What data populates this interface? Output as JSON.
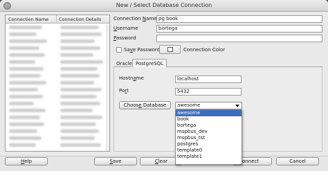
{
  "window": {
    "title": "New / Select Database Connection"
  },
  "connections": {
    "columns": [
      "Connection Name",
      "Connection Details"
    ]
  },
  "form": {
    "connection_name": {
      "label_pre": "Connection ",
      "label_ul": "N",
      "label_post": "ame",
      "value": "pg book"
    },
    "username": {
      "label_ul": "U",
      "label_post": "sername",
      "value": "bortega"
    },
    "password": {
      "label_ul": "P",
      "label_post": "assword",
      "value": ""
    },
    "save_password": {
      "label_pre": "Sa",
      "label_ul": "v",
      "label_post": "e Password",
      "checked": false
    },
    "connection_color": {
      "label": "Connection Color"
    }
  },
  "tabs": {
    "oracle": "Oracle",
    "postgresql": "PostgreSQL",
    "active": "PostgreSQL"
  },
  "postgres": {
    "hostname": {
      "label_pre": "Hostn",
      "label_ul": "a",
      "label_post": "me",
      "value": "localhost"
    },
    "port": {
      "label_pre": "Po",
      "label_ul": "r",
      "label_post": "t",
      "value": "5432"
    },
    "choose_db": {
      "label_pre": "Choos",
      "label_ul": "e",
      "label_post": " Database"
    },
    "database": {
      "selected": "awesome",
      "options": [
        "awesome",
        "book",
        "bortega",
        "mspbus_dev",
        "mspbus_tst",
        "postgres",
        "template0",
        "template1"
      ]
    }
  },
  "buttons": {
    "help": {
      "ul": "H",
      "rest": "elp"
    },
    "save": {
      "ul": "S",
      "rest": "ave"
    },
    "clear": {
      "ul": "C",
      "rest": "lear"
    },
    "connect": {
      "ul": "",
      "rest": "onnect"
    },
    "cancel": {
      "ul": "",
      "rest": "Cancel"
    }
  }
}
